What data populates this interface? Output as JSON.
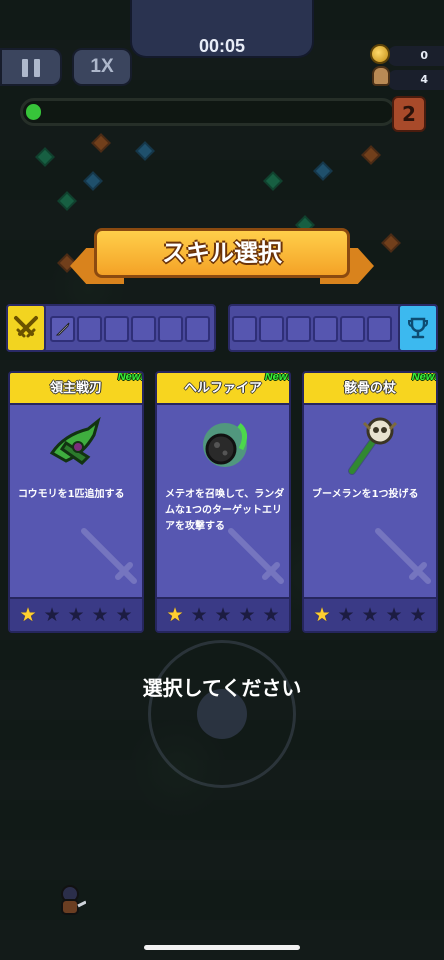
{
  "hud": {
    "timer": "00:05",
    "speed_label": "1X",
    "coin_count": "0",
    "kill_count": "4",
    "level": "2",
    "xp_progress": 0.04
  },
  "title": "スキル選択",
  "prompt": "選択してください",
  "cards": [
    {
      "name": "領主戦刃",
      "badge": "New!",
      "description": "コウモリを1匹追加する",
      "stars_filled": 1,
      "stars_total": 5,
      "icon": "lord-blade-icon"
    },
    {
      "name": "ヘルファイア",
      "badge": "New!",
      "description": "メテオを召喚して、ランダムな1つのターゲットエリアを攻撃する",
      "stars_filled": 1,
      "stars_total": 5,
      "icon": "hellfire-meteor-icon"
    },
    {
      "name": "骸骨の杖",
      "badge": "New!",
      "description": "ブーメランを1つ投げる",
      "stars_filled": 1,
      "stars_total": 5,
      "icon": "skull-staff-icon"
    }
  ],
  "colors": {
    "card_bg": "#5757b1",
    "card_header": "#f7d51f",
    "new_badge": "#3af23a",
    "ribbon": "#f4a227",
    "weapon_slot": "#f2d420",
    "passive_slot": "#3cb9ef"
  }
}
